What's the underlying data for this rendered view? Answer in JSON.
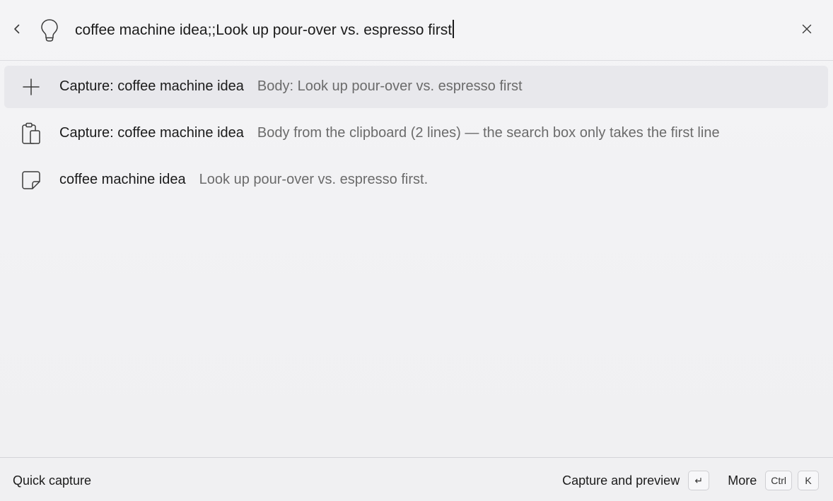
{
  "search": {
    "value": "coffee machine idea;;Look up pour-over vs. espresso first",
    "mode_icon": "lightbulb-icon"
  },
  "results": [
    {
      "icon": "plus-icon",
      "title": "Capture: coffee machine idea",
      "subtitle": "Body: Look up pour-over vs. espresso first"
    },
    {
      "icon": "clipboard-icon",
      "title": "Capture: coffee machine idea",
      "subtitle": "Body from the clipboard (2 lines) — the search box only takes the first line"
    },
    {
      "icon": "sticky-note-icon",
      "title": "coffee machine idea",
      "subtitle": "Look up pour-over vs. espresso first."
    }
  ],
  "footer": {
    "title": "Quick capture",
    "primary_action": "Capture and preview",
    "primary_key": "↵",
    "more_label": "More",
    "more_key_1": "Ctrl",
    "more_key_2": "K"
  }
}
